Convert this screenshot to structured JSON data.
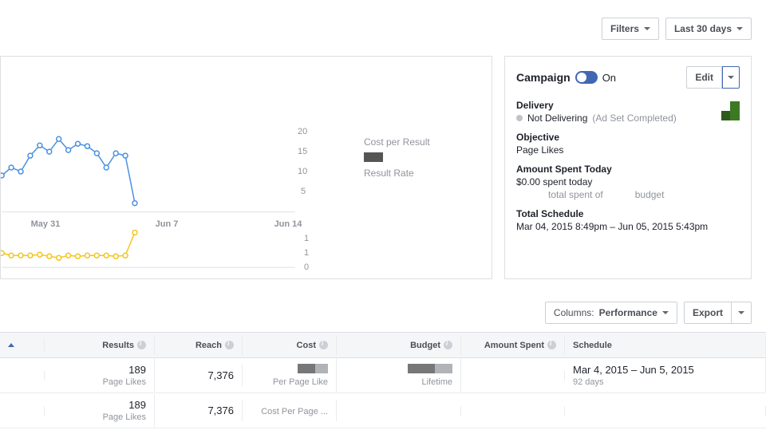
{
  "topbar": {
    "filters_label": "Filters",
    "daterange_label": "Last 30 days"
  },
  "chart_legend": {
    "cost_per_result": "Cost per Result",
    "result_rate": "Result Rate"
  },
  "chart_data": [
    {
      "type": "line",
      "title": "",
      "xlabel": "",
      "ylabel": "",
      "ylim": [
        0,
        20
      ],
      "y_ticks": [
        5,
        10,
        15,
        20
      ],
      "x_ticks": [
        "May 31",
        "Jun 7",
        "Jun 14"
      ],
      "series": [
        {
          "name": "Cost per Result",
          "color": "#4a90e2",
          "x": [
            0,
            1,
            2,
            3,
            4,
            5,
            6,
            7,
            8,
            9,
            10,
            11,
            12,
            13,
            14
          ],
          "values": [
            8,
            10,
            9,
            13,
            16,
            14,
            18,
            15,
            17,
            16,
            14,
            10,
            14,
            13,
            3
          ]
        }
      ]
    },
    {
      "type": "line",
      "title": "",
      "xlabel": "",
      "ylabel": "",
      "ylim": [
        0,
        1
      ],
      "y_ticks": [
        0,
        1,
        1
      ],
      "series": [
        {
          "name": "Result Rate",
          "color": "#f5c518",
          "x": [
            0,
            1,
            2,
            3,
            4,
            5,
            6,
            7,
            8,
            9,
            10,
            11,
            12,
            13,
            14
          ],
          "values": [
            0.35,
            0.3,
            0.3,
            0.3,
            0.32,
            0.28,
            0.25,
            0.3,
            0.28,
            0.3,
            0.3,
            0.3,
            0.28,
            0.3,
            0.95
          ]
        }
      ]
    }
  ],
  "campaign_panel": {
    "title": "Campaign",
    "on_label": "On",
    "edit_label": "Edit",
    "delivery_head": "Delivery",
    "delivery_status": "Not Delivering",
    "delivery_detail": "(Ad Set Completed)",
    "objective_head": "Objective",
    "objective_value": "Page Likes",
    "spent_head": "Amount Spent Today",
    "spent_value": "$0.00 spent today",
    "spent_sub_left": "total spent of",
    "spent_sub_right": "budget",
    "schedule_head": "Total Schedule",
    "schedule_value": "Mar 04, 2015 8:49pm – Jun 05, 2015 5:43pm"
  },
  "mid_toolbar": {
    "columns_prefix": "Columns:",
    "columns_value": "Performance",
    "export_label": "Export"
  },
  "table": {
    "headers": {
      "results": "Results",
      "reach": "Reach",
      "cost": "Cost",
      "budget": "Budget",
      "amount_spent": "Amount Spent",
      "schedule": "Schedule"
    },
    "rows": [
      {
        "results": "189",
        "results_sub": "Page Likes",
        "reach": "7,376",
        "cost_sub": "Per Page Like",
        "budget_sub": "Lifetime",
        "schedule": "Mar 4, 2015 – Jun 5, 2015",
        "schedule_sub": "92 days"
      },
      {
        "results": "189",
        "results_sub": "Page Likes",
        "reach": "7,376",
        "cost_sub": "Cost Per Page ...",
        "budget_sub": "",
        "schedule": "",
        "schedule_sub": ""
      }
    ]
  }
}
